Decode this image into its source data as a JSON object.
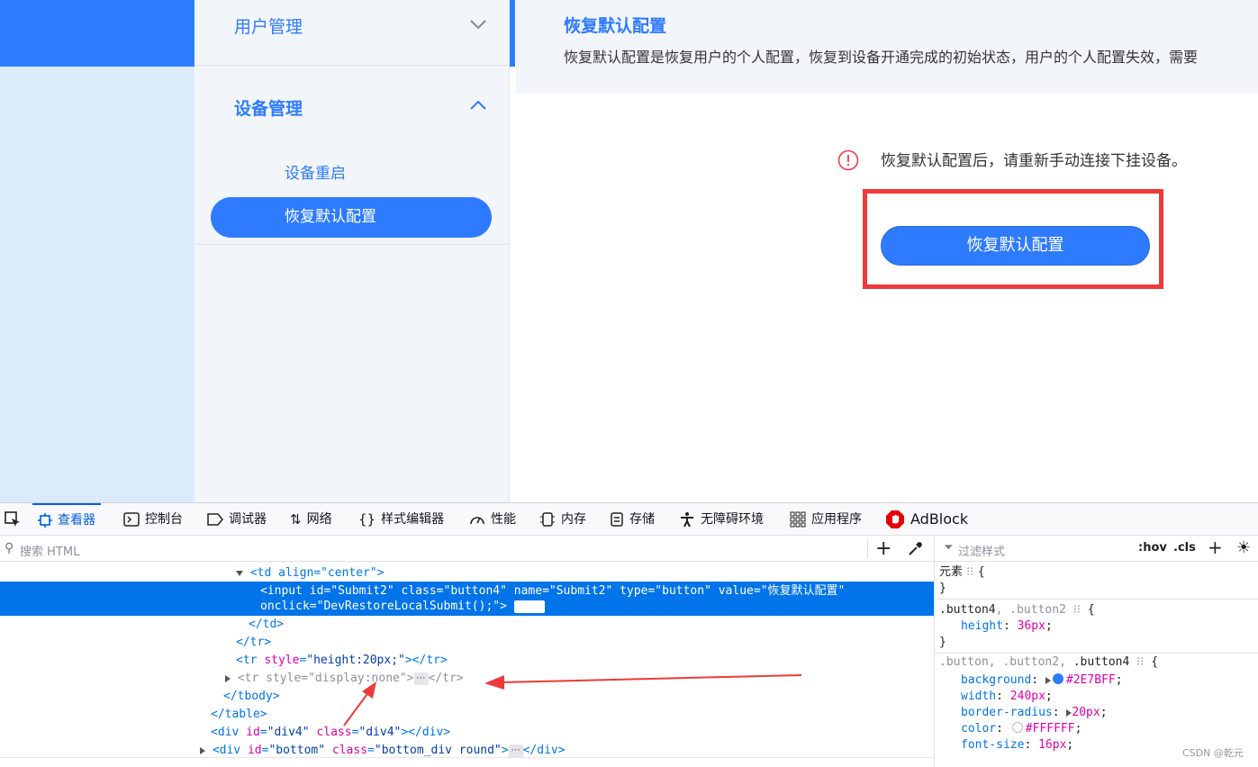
{
  "sidebar": {
    "user_mgmt": "用户管理",
    "device_mgmt": "设备管理",
    "items": [
      {
        "label": "设备重启",
        "active": false
      },
      {
        "label": "恢复默认配置",
        "active": true
      }
    ]
  },
  "content": {
    "title": "恢复默认配置",
    "description": "恢复默认配置是恢复用户的个人配置，恢复到设备开通完成的初始状态，用户的个人配置失效，需要",
    "warning": "恢复默认配置后，请重新手动连接下挂设备。",
    "restore_button": "恢复默认配置"
  },
  "devtools": {
    "tabs": [
      {
        "label": "查看器",
        "icon": "inspector-icon",
        "active": true
      },
      {
        "label": "控制台",
        "icon": "console-icon",
        "active": false
      },
      {
        "label": "调试器",
        "icon": "debugger-icon",
        "active": false
      },
      {
        "label": "网络",
        "icon": "network-icon",
        "active": false
      },
      {
        "label": "样式编辑器",
        "icon": "style-editor-icon",
        "active": false
      },
      {
        "label": "性能",
        "icon": "performance-icon",
        "active": false
      },
      {
        "label": "内存",
        "icon": "memory-icon",
        "active": false
      },
      {
        "label": "存储",
        "icon": "storage-icon",
        "active": false
      },
      {
        "label": "无障碍环境",
        "icon": "accessibility-icon",
        "active": false
      },
      {
        "label": "应用程序",
        "icon": "application-icon",
        "active": false
      },
      {
        "label": "AdBlock",
        "icon": "adblock-icon",
        "active": false
      }
    ],
    "search_placeholder": "搜索 HTML",
    "filter_placeholder": "过滤样式",
    "hov": ":hov",
    "cls": ".cls",
    "html": {
      "td_open": "<td align=\"center\">",
      "input_line1": "<input id=\"Submit2\" class=\"button4\" name=\"Submit2\" type=\"button\" value=\"恢复默认配置\"",
      "input_line2": "onclick=\"DevRestoreLocalSubmit();\">",
      "event_badge": "event",
      "td_close": "</td>",
      "tr_close": "</tr>",
      "tr_height": "<tr style=\"height:20px;\"></tr>",
      "tr_hidden_open": "<tr style=\"display:none\">",
      "tr_hidden_close": "</tr>",
      "ellipsis": "⋯",
      "tbody_close": "</tbody>",
      "table_close": "</table>",
      "div4": "<div id=\"div4\" class=\"div4\"></div>",
      "div_bottom_open": "<div id=\"bottom\" class=\"bottom_div round\">",
      "div_bottom_close": "</div>"
    },
    "rules": {
      "element_label": "元素",
      "brace_open": "{",
      "brace_close": "}",
      "rule1_selector_a": ".button4",
      "rule1_selector_b": ", .button2",
      "rule1_prop": "height",
      "rule1_value": "36px",
      "rule2_selector": ".button, .button2, .button4",
      "rule2_props": [
        {
          "name": "background",
          "value": "#2E7BFF",
          "swatch": "#2E7BFF"
        },
        {
          "name": "width",
          "value": "240px"
        },
        {
          "name": "border-radius",
          "value": "20px"
        },
        {
          "name": "color",
          "value": "#FFFFFF",
          "swatch": "#FFFFFF"
        },
        {
          "name": "font-size",
          "value": "16px"
        }
      ]
    }
  },
  "watermark": "CSDN @乾元",
  "colors": {
    "accent": "#2e7bff",
    "highlight": "#ee3a3a",
    "devtools_selection": "#0074e8"
  }
}
